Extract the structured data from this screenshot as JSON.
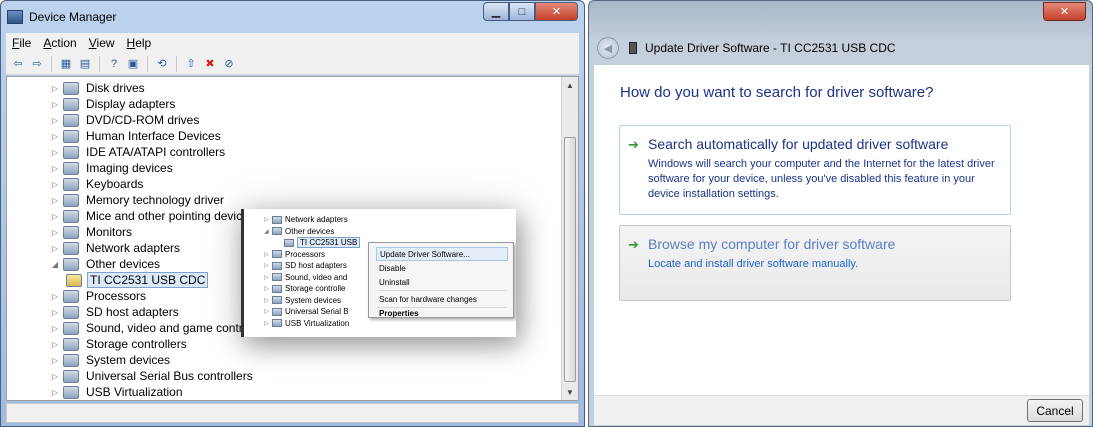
{
  "device_manager": {
    "title": "Device Manager",
    "menu": [
      "File",
      "Action",
      "View",
      "Help"
    ],
    "toolbar_icons": [
      "back-icon",
      "forward-icon",
      "properties-view-icon",
      "show-hidden-icon",
      "help-icon",
      "console-icon",
      "scan-icon",
      "update-driver-icon",
      "uninstall-icon",
      "disable-icon"
    ],
    "tree": [
      {
        "label": "Disk drives",
        "arrow": "▷",
        "icon": "disk-drive-icon"
      },
      {
        "label": "Display adapters",
        "arrow": "▷",
        "icon": "display-adapter-icon"
      },
      {
        "label": "DVD/CD-ROM drives",
        "arrow": "▷",
        "icon": "dvd-drive-icon"
      },
      {
        "label": "Human Interface Devices",
        "arrow": "▷",
        "icon": "hid-icon"
      },
      {
        "label": "IDE ATA/ATAPI controllers",
        "arrow": "▷",
        "icon": "ide-controller-icon"
      },
      {
        "label": "Imaging devices",
        "arrow": "▷",
        "icon": "imaging-device-icon"
      },
      {
        "label": "Keyboards",
        "arrow": "▷",
        "icon": "keyboard-icon"
      },
      {
        "label": "Memory technology driver",
        "arrow": "▷",
        "icon": "memory-icon"
      },
      {
        "label": "Mice and other pointing devices",
        "arrow": "▷",
        "icon": "mouse-icon"
      },
      {
        "label": "Monitors",
        "arrow": "▷",
        "icon": "monitor-icon"
      },
      {
        "label": "Network adapters",
        "arrow": "▷",
        "icon": "network-adapter-icon"
      },
      {
        "label": "Other devices",
        "arrow": "◢",
        "icon": "other-devices-icon"
      },
      {
        "label": "TI CC2531 USB CDC",
        "arrow": "",
        "icon": "unknown-device-warning-icon"
      },
      {
        "label": "Processors",
        "arrow": "▷",
        "icon": "processor-icon"
      },
      {
        "label": "SD host adapters",
        "arrow": "▷",
        "icon": "sd-host-icon"
      },
      {
        "label": "Sound, video and game controllers",
        "arrow": "▷",
        "icon": "sound-icon"
      },
      {
        "label": "Storage controllers",
        "arrow": "▷",
        "icon": "storage-controller-icon"
      },
      {
        "label": "System devices",
        "arrow": "▷",
        "icon": "system-device-icon"
      },
      {
        "label": "Universal Serial Bus controllers",
        "arrow": "▷",
        "icon": "usb-controller-icon"
      },
      {
        "label": "USB Virtualization",
        "arrow": "▷",
        "icon": "usb-virtualization-icon"
      }
    ]
  },
  "callout": {
    "tree": [
      "Network adapters",
      "Other devices",
      "TI CC2531 USB",
      "Processors",
      "SD host adapters",
      "Sound, video and",
      "Storage controlle",
      "System devices",
      "Universal Serial B",
      "USB Virtualization"
    ],
    "context_menu": [
      "Update Driver Software...",
      "Disable",
      "Uninstall",
      "Scan for hardware changes",
      "Properties"
    ]
  },
  "update_dialog": {
    "title": "Update Driver Software - TI CC2531 USB CDC",
    "question": "How do you want to search for driver software?",
    "option_auto": {
      "title": "Search automatically for updated driver software",
      "desc": "Windows will search your computer and the Internet for the latest driver software for your device, unless you've disabled this feature in your device installation settings."
    },
    "option_browse": {
      "title": "Browse my computer for driver software",
      "desc": "Locate and install driver software manually."
    },
    "cancel": "Cancel"
  }
}
